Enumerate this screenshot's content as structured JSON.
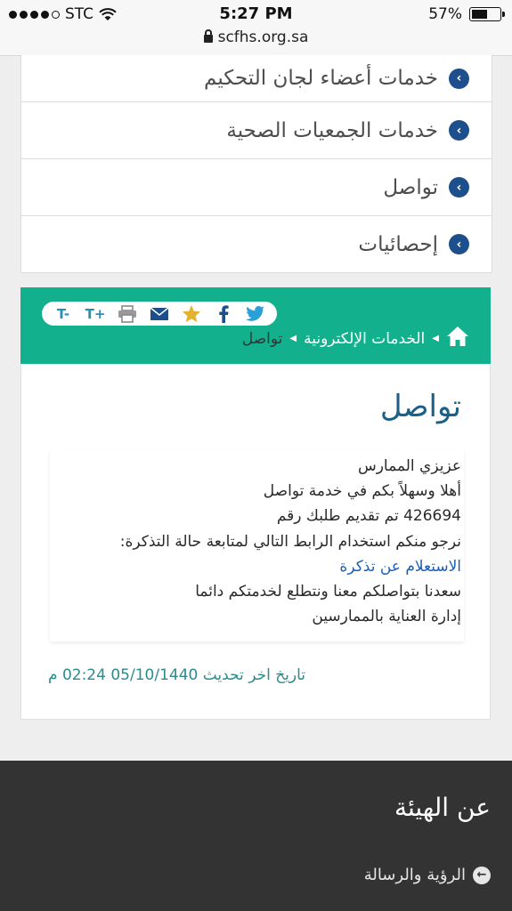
{
  "status_bar": {
    "carrier": "STC",
    "time": "5:27 PM",
    "battery": "57%",
    "battery_level": 0.57,
    "url": "scfhs.org.sa"
  },
  "menu": {
    "items": [
      {
        "label": "خدمات أعضاء لجان التحكيم"
      },
      {
        "label": "خدمات الجمعيات الصحية"
      },
      {
        "label": "تواصل"
      },
      {
        "label": "إحصائيات"
      }
    ]
  },
  "share_bar": {
    "font_smaller": "T-",
    "font_larger": "T+"
  },
  "breadcrumb": {
    "section": "الخدمات الإلكترونية",
    "current": "تواصل"
  },
  "content": {
    "title": "تواصل",
    "lines": {
      "greeting": "عزيزي الممارس",
      "welcome": "أهلا وسهلاً بكم في خدمة تواصل",
      "request": "426694 تم تقديم طلبك رقم",
      "instruction": "نرجو منكم استخدام الرابط التالي لمتابعة حالة التذكرة:",
      "link": "الاستعلام عن تذكرة",
      "thanks": "سعدنا بتواصلكم معنا ونتطلع لخدمتكم دائما",
      "signature": "إدارة العناية بالممارسين"
    },
    "last_updated": "تاريخ اخر تحديث 05/10/1440 02:24 م"
  },
  "footer": {
    "title": "عن الهيئة",
    "link": "الرؤية والرسالة"
  },
  "colors": {
    "primary_green": "#12b08d",
    "navy": "#1c4f8c",
    "title_blue": "#1c5f87",
    "footer_bg": "#333333"
  }
}
